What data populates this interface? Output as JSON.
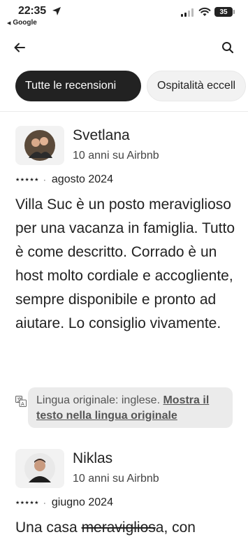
{
  "status_bar": {
    "time": "22:35",
    "back_app": "Google",
    "battery": "35"
  },
  "nav": {
    "back_icon": "arrow-left-icon",
    "search_icon": "search-icon"
  },
  "chips": [
    {
      "label": "Tutte le recensioni",
      "active": true
    },
    {
      "label": "Ospitalità eccell",
      "active": false
    }
  ],
  "reviews": [
    {
      "name": "Svetlana",
      "years": "10 anni su Airbnb",
      "rating": 5,
      "stars_text": "★★★★★",
      "date": "agosto 2024",
      "text": "Villa Suc è un posto meraviglioso per una vacanza in famiglia. Tutto è come descritto. Corrado è un host molto cordiale e accogliente, sempre disponibile e pronto ad aiutare. Lo consiglio vivamente."
    },
    {
      "name": "Niklas",
      "years": "10 anni su Airbnb",
      "rating": 5,
      "stars_text": "★★★★★",
      "date": "giugno 2024",
      "text_start": "Una casa ",
      "text_strike": "meraviglios",
      "text_end": "a, con"
    }
  ],
  "translation": {
    "label": "Lingua originale: inglese. ",
    "link": "Mostra il testo nella lingua originale"
  },
  "colors": {
    "text": "#222222",
    "chip_active_bg": "#222222",
    "translation_bg": "#ebebeb"
  }
}
